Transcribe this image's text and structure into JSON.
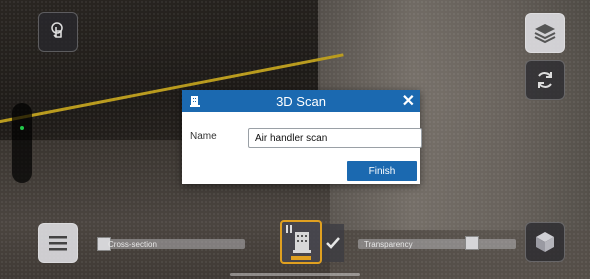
{
  "dialog": {
    "title": "3D Scan",
    "close_label": "✕",
    "name_label": "Name",
    "name_value": "Air handler scan",
    "finish_label": "Finish"
  },
  "bottom_bar": {
    "cross_section_label": "Cross-section",
    "transparency_label": "Transparency",
    "cross_section_value": 0.0,
    "transparency_value": 0.74
  },
  "icons": {
    "top_left": "touch-gesture-icon",
    "top_right": "layers-icon",
    "refresh": "refresh-icon",
    "menu": "hamburger-menu-icon",
    "scan": "scan-building-icon",
    "check": "checkmark-icon",
    "cube": "cube-view-icon",
    "dialog_header": "scan-building-icon"
  },
  "colors": {
    "dialog_header": "#1b69b0",
    "finish_button": "#1b69b0",
    "scan_toggle_border": "#e0a020",
    "status_dot": "#22c84a"
  }
}
